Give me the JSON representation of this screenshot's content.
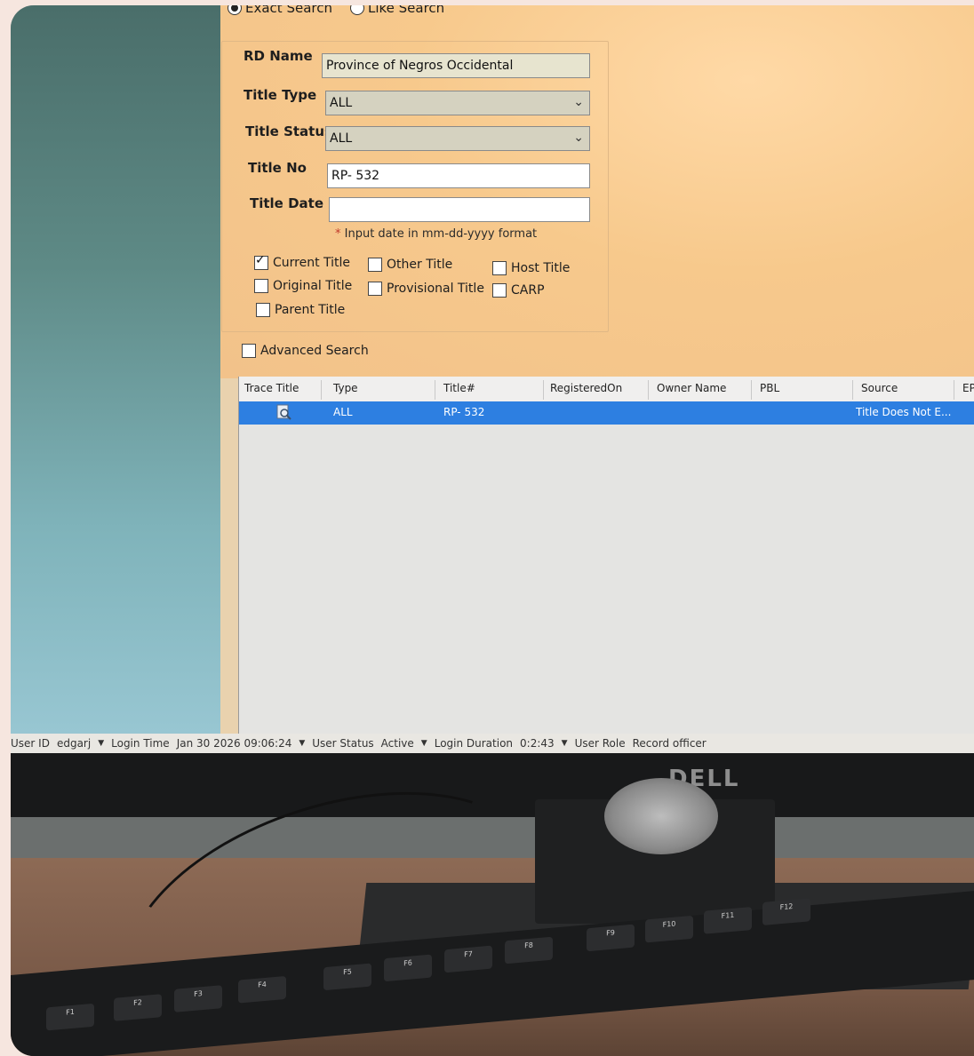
{
  "search_mode": {
    "exact_label": "Exact Search",
    "like_label": "Like Search",
    "selected": "exact"
  },
  "form": {
    "rd_name": {
      "label": "RD Name",
      "value": "Province of Negros Occidental"
    },
    "title_type": {
      "label": "Title Type",
      "value": "ALL"
    },
    "title_status": {
      "label": "Title Status",
      "value": "ALL"
    },
    "title_no": {
      "label": "Title No",
      "value": "RP- 532"
    },
    "title_date": {
      "label": "Title Date",
      "value": ""
    },
    "date_hint": "Input date in  mm-dd-yyyy  format",
    "date_hint_star": "*"
  },
  "checkboxes": [
    {
      "label": "Current Title",
      "checked": true
    },
    {
      "label": "Other Title",
      "checked": false
    },
    {
      "label": "Host Title",
      "checked": false
    },
    {
      "label": "Original Title",
      "checked": false
    },
    {
      "label": "Provisional Title",
      "checked": false
    },
    {
      "label": "CARP",
      "checked": false
    },
    {
      "label": "Parent Title",
      "checked": false
    }
  ],
  "advanced_search": {
    "label": "Advanced Search",
    "checked": false
  },
  "grid": {
    "columns": [
      "Trace Title",
      "Type",
      "Title#",
      "RegisteredOn",
      "Owner Name",
      "PBL",
      "Source",
      "EP"
    ],
    "rows": [
      {
        "type": "ALL",
        "title_no": "RP- 532",
        "registered_on": "",
        "owner_name": "",
        "pbl": "",
        "source": "Title Does Not E..."
      }
    ]
  },
  "status_bar": {
    "user_id_label": "User ID",
    "user_id": "edgarj",
    "login_time_label": "Login Time",
    "login_time": "Jan 30 2026 09:06:24",
    "user_status_label": "User Status",
    "user_status": "Active",
    "login_duration_label": "Login Duration",
    "login_duration": "0:2:43",
    "user_role_label": "User Role",
    "user_role": "Record officer"
  },
  "monitor_brand": "DELL",
  "keys": [
    "F1",
    "F2",
    "F3",
    "F4",
    "F5",
    "F6",
    "F7",
    "F8",
    "F9",
    "F10",
    "F11",
    "F12"
  ],
  "colors": {
    "selection": "#2d7fe1",
    "app_bg": "#f7c98c"
  }
}
